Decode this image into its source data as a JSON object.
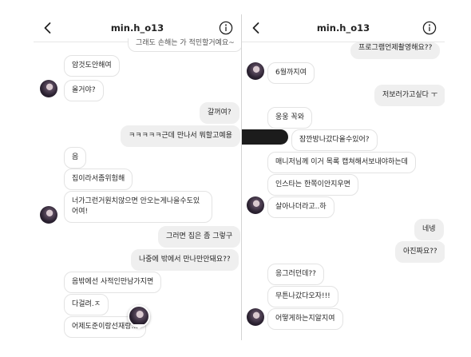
{
  "left": {
    "title": "min.h_o13",
    "cut_top": "그래도 손해는 가 적민할거예요~",
    "messages": [
      "암것도안해여",
      "올거야?",
      "갈꺼여?",
      "ㅋㅋㅋㅋㅋ근데 만나서 뭐할고예용",
      "음",
      "집이라서좀위험해",
      "너가그런거원치않으면 안오는게나을수도있어여!",
      "그러면 집은 좀 그렇구",
      "나중에 밖에서 만나만안돼요??",
      "음밖에선 사적인만남가지면",
      "다걸려.ㅈ",
      "어제도준이랑선재랑..."
    ]
  },
  "right": {
    "title": "min.h_o13",
    "messages": [
      "프로그램언제촬영해요??",
      "6월까지여",
      "저보러가고싶다 ㅜ",
      "웅웅 꼭와",
      "잠깐방나갔다올수있어?",
      "매니저님께 이거 목록 캡쳐해서보내야하는데",
      "인스타는 한쪽이안지우면",
      "살아나더라고..하",
      "네넹",
      "아진짜요??",
      "응그러던데??",
      "무튼나갔다오자!!!",
      "어떻게하는지알지여"
    ]
  }
}
